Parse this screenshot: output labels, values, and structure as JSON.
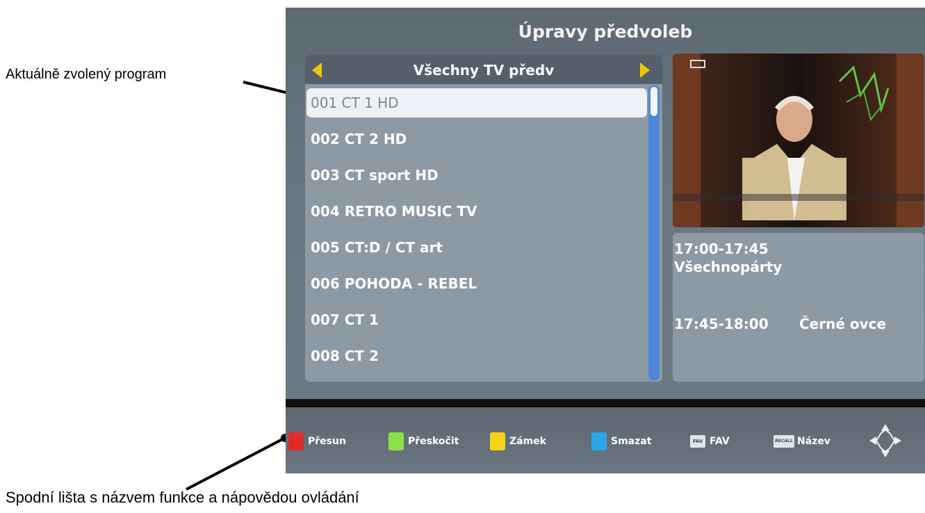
{
  "annotations": {
    "selected_program": "Aktuálně zvolený program",
    "bottom_bar": "Spodní lišta s názvem funkce a nápovědou ovládání"
  },
  "screen": {
    "title": "Úpravy předvoleb",
    "list": {
      "header": "Všechny TV předv",
      "selected_index": 0,
      "channels": [
        "001 CT 1 HD",
        "002 CT 2 HD",
        "003 CT sport HD",
        "004 RETRO MUSIC TV",
        "005 CT:D / CT art",
        "006 POHODA - REBEL",
        "007 CT 1",
        "008 CT 2"
      ]
    },
    "epg": {
      "now_time": "17:00-17:45",
      "now_title": "Všechnopárty",
      "next_time": "17:45-18:00",
      "next_title": "Černé ovce"
    },
    "bottom_keys": [
      {
        "label": "Přesun",
        "color": "#e02a2a"
      },
      {
        "label": "Přeskočit",
        "color": "#8ee04a"
      },
      {
        "label": "Zámek",
        "color": "#f5d417"
      },
      {
        "label": "Smazat",
        "color": "#2aa6e8"
      },
      {
        "label": "FAV",
        "tag": "FAV"
      },
      {
        "label": "Název",
        "tag": "RECALL"
      }
    ],
    "preview_overlay": "Všechnopárty"
  },
  "colors": {
    "accent_arrow": "#f1c40f",
    "scrollbar": "#4e86d8",
    "panel": "#8e9aa3"
  }
}
